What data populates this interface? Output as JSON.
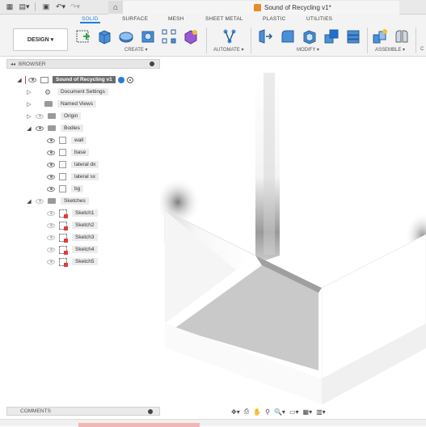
{
  "app": {
    "document_title": "Sound of Recycling v1*"
  },
  "tabs": [
    {
      "label": "SOLID",
      "active": true
    },
    {
      "label": "SURFACE",
      "active": false
    },
    {
      "label": "MESH",
      "active": false
    },
    {
      "label": "SHEET METAL",
      "active": false
    },
    {
      "label": "PLASTIC",
      "active": false
    },
    {
      "label": "UTILITIES",
      "active": false
    }
  ],
  "toolbar": {
    "workspace_label": "DESIGN ▾",
    "groups": {
      "create": "CREATE ▾",
      "automate": "AUTOMATE ▾",
      "modify": "MODIFY ▾",
      "assemble": "ASSEMBLE ▾",
      "more": "C"
    }
  },
  "browser": {
    "header": "BROWSER",
    "root": "Sound of Recycling v1",
    "document_settings": "Document Settings",
    "named_views": "Named Views",
    "origin": "Origin",
    "bodies_folder": "Bodies",
    "bodies": [
      "wall",
      "base",
      "lateral dx",
      "lateral sx",
      "bg"
    ],
    "sketches_folder": "Sketches",
    "sketches": [
      "Sketch1",
      "Sketch2",
      "Sketch3",
      "Sketch4",
      "Sketch5"
    ]
  },
  "comments": {
    "label": "COMMENTS"
  },
  "colors": {
    "accent": "#1d7fd8",
    "sketch_marker": "#e23b3b"
  }
}
